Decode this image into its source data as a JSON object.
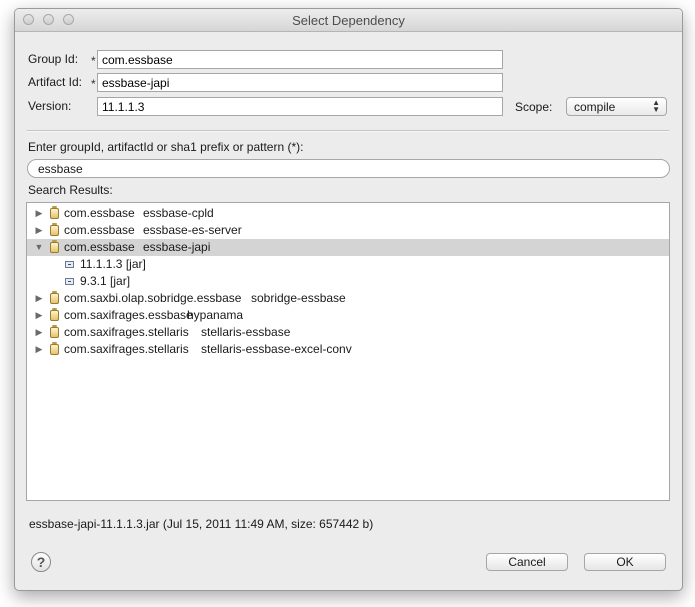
{
  "window": {
    "title": "Select Dependency"
  },
  "form": {
    "group_id_label": "Group Id:",
    "group_id_value": "com.essbase",
    "artifact_id_label": "Artifact Id:",
    "artifact_id_value": "essbase-japi",
    "version_label": "Version:",
    "version_value": "11.1.1.3",
    "scope_label": "Scope:",
    "scope_value": "compile",
    "required_marker": "*"
  },
  "search": {
    "label": "Enter groupId, artifactId or sha1 prefix or pattern (*):",
    "value": "essbase",
    "results_label": "Search Results:"
  },
  "results": [
    {
      "group": "com.essbase",
      "artifact": "essbase-cpld",
      "expanded": false
    },
    {
      "group": "com.essbase",
      "artifact": "essbase-es-server",
      "expanded": false
    },
    {
      "group": "com.essbase",
      "artifact": "essbase-japi",
      "expanded": true,
      "selected": true,
      "versions": [
        "11.1.1.3 [jar]",
        "9.3.1 [jar]"
      ]
    },
    {
      "group": "com.saxbi.olap.sobridge.essbase",
      "artifact": "sobridge-essbase",
      "expanded": false
    },
    {
      "group": "com.saxifrages.essbase",
      "artifact": "hypanama",
      "expanded": false
    },
    {
      "group": "com.saxifrages.stellaris",
      "artifact": "stellaris-essbase",
      "expanded": false
    },
    {
      "group": "com.saxifrages.stellaris",
      "artifact": "stellaris-essbase-excel-conv",
      "expanded": false
    }
  ],
  "status_text": "essbase-japi-11.1.1.3.jar (Jul 15, 2011 11:49 AM, size: 657442 b)",
  "buttons": {
    "help": "?",
    "cancel": "Cancel",
    "ok": "OK"
  },
  "icons": {
    "collapsed": "disclosure-right-icon",
    "expanded": "disclosure-down-icon",
    "artifact": "jar-icon",
    "version": "jar-file-icon"
  }
}
